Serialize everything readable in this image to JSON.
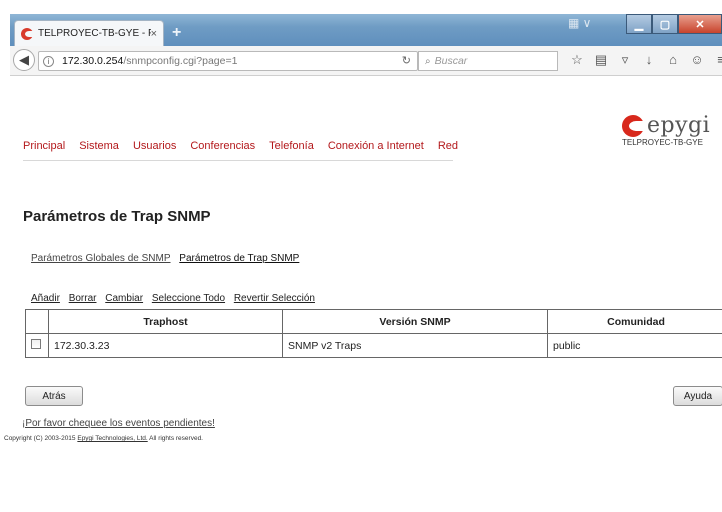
{
  "browser": {
    "tab_title": "TELPROYEC-TB-GYE - Pará...",
    "tab_close": "×",
    "new_tab": "+",
    "url_host": "172.30.0.254",
    "url_path": "/snmpconfig.cgi?page=1",
    "search_placeholder": "Buscar"
  },
  "nav": {
    "items": [
      "Principal",
      "Sistema",
      "Usuarios",
      "Conferencias",
      "Telefonía",
      "Conexión a Internet",
      "Red"
    ]
  },
  "brand": {
    "logo_text": "epygi",
    "host_label": "TELPROYEC-TB-GYE"
  },
  "page": {
    "title": "Parámetros de Trap SNMP",
    "sub_links": [
      "Parámetros Globales de SNMP",
      "Parámetros de Trap SNMP"
    ],
    "actions": [
      "Añadir",
      "Borrar",
      "Cambiar",
      "Seleccione Todo",
      "Revertir Selección"
    ]
  },
  "table": {
    "headers": [
      "Traphost",
      "Versión SNMP",
      "Comunidad"
    ],
    "rows": [
      {
        "traphost": "172.30.3.23",
        "version": "SNMP v2 Traps",
        "community": "public"
      }
    ]
  },
  "buttons": {
    "back": "Atrás",
    "help": "Ayuda"
  },
  "footer": {
    "pending": "¡Por favor chequee los eventos pendientes!",
    "copyright_prefix": "Copyright (C) 2003-2015 ",
    "copyright_link": "Epygi Technologies, Ltd.",
    "copyright_suffix": " All rights reserved."
  },
  "colors": {
    "nav_red": "#b3181b",
    "brand_red": "#d8281c"
  }
}
